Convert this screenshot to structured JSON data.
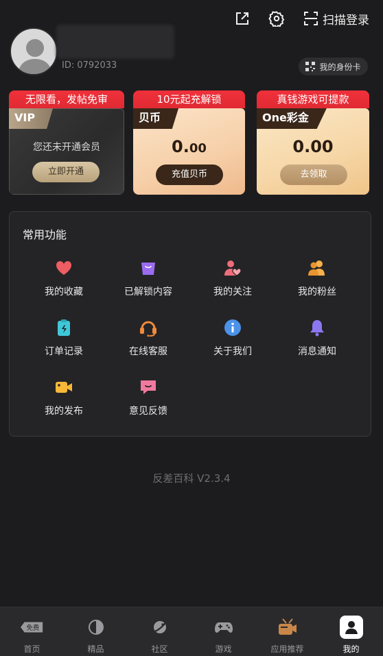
{
  "topbar": {
    "share_icon": "external-link-icon",
    "settings_icon": "gear-icon",
    "scan_icon": "scan-icon",
    "scan_login_label": "扫描登录"
  },
  "profile": {
    "user_id_text": "ID: 0792033",
    "id_card_label": "我的身份卡"
  },
  "cards": {
    "vip": {
      "banner": "无限看，发帖免审",
      "tag": "VIP",
      "message": "您还未开通会员",
      "button": "立即开通"
    },
    "coin": {
      "banner": "10元起充解锁",
      "tag": "贝币",
      "amount_int": "0.",
      "amount_dec": "00",
      "button": "充值贝币"
    },
    "one": {
      "banner": "真钱游戏可提款",
      "tag": "One彩金",
      "amount": "0.00",
      "button": "去领取"
    }
  },
  "functions": {
    "title": "常用功能",
    "items": [
      {
        "label": "我的收藏",
        "icon": "heart-icon"
      },
      {
        "label": "已解锁内容",
        "icon": "bag-icon"
      },
      {
        "label": "我的关注",
        "icon": "follow-icon"
      },
      {
        "label": "我的粉丝",
        "icon": "fans-icon"
      },
      {
        "label": "订单记录",
        "icon": "order-icon"
      },
      {
        "label": "在线客服",
        "icon": "headset-icon"
      },
      {
        "label": "关于我们",
        "icon": "info-icon"
      },
      {
        "label": "消息通知",
        "icon": "bell-icon"
      },
      {
        "label": "我的发布",
        "icon": "video-camera-icon"
      },
      {
        "label": "意见反馈",
        "icon": "feedback-icon"
      }
    ]
  },
  "version": "反差百科 V2.3.4",
  "nav": {
    "items": [
      {
        "label": "首页",
        "badge": "免费"
      },
      {
        "label": "精品"
      },
      {
        "label": "社区"
      },
      {
        "label": "游戏"
      },
      {
        "label": "应用推荐"
      },
      {
        "label": "我的"
      }
    ],
    "active": "我的"
  },
  "colors": {
    "background": "#1c1c1e",
    "banner_red": "#e02a33",
    "gold": "#b8a27c"
  }
}
